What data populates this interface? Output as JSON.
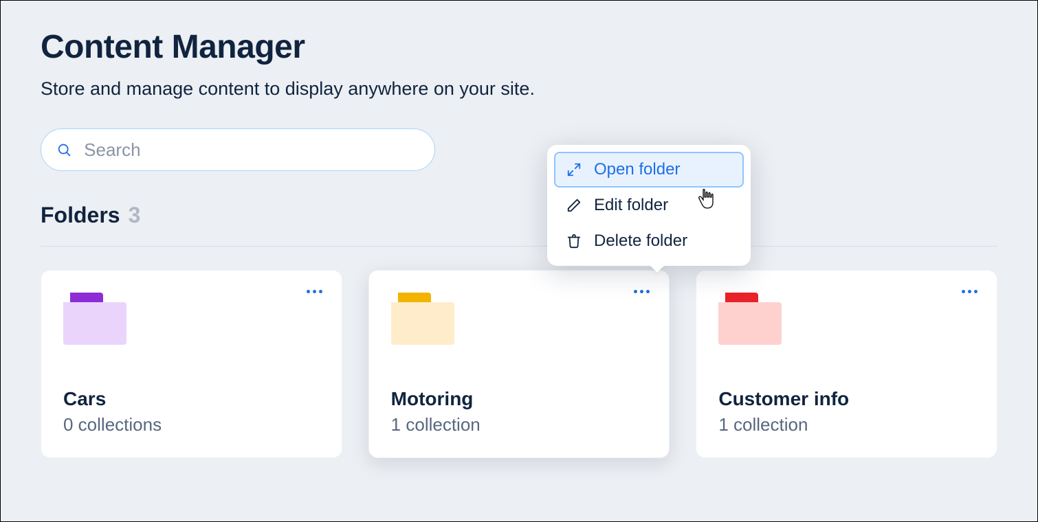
{
  "header": {
    "title": "Content Manager",
    "subtitle": "Store and manage content to display anywhere on your site."
  },
  "search": {
    "placeholder": "Search"
  },
  "folders_section": {
    "label": "Folders",
    "count": "3",
    "cards": [
      {
        "name": "Cars",
        "meta": "0 collections",
        "folder_colors": {
          "tab": "#8e2dd6",
          "body": "#ead4fb"
        }
      },
      {
        "name": "Motoring",
        "meta": "1 collection",
        "folder_colors": {
          "tab": "#f2b400",
          "body": "#ffeccb"
        }
      },
      {
        "name": "Customer info",
        "meta": "1 collection",
        "folder_colors": {
          "tab": "#e8232a",
          "body": "#ffd1ce"
        }
      }
    ]
  },
  "context_menu": {
    "items": [
      {
        "label": "Open folder",
        "icon": "expand-icon",
        "selected": true
      },
      {
        "label": "Edit folder",
        "icon": "pencil-icon",
        "selected": false
      },
      {
        "label": "Delete folder",
        "icon": "trash-icon",
        "selected": false
      }
    ]
  }
}
